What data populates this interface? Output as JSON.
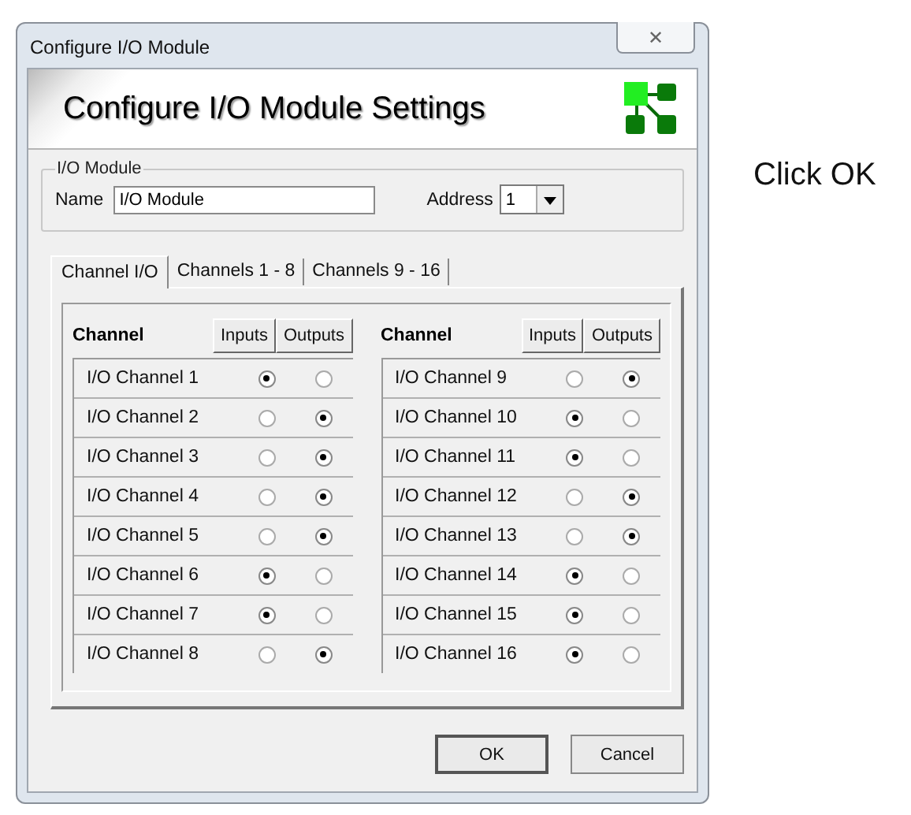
{
  "window": {
    "title": "Configure I/O Module",
    "close_label": "✕"
  },
  "banner": {
    "title": "Configure I/O Module Settings"
  },
  "module_group": {
    "legend": "I/O Module",
    "name_label": "Name",
    "name_value": "I/O Module",
    "address_label": "Address",
    "address_value": "1"
  },
  "tabs": [
    {
      "label": "Channel I/O",
      "selected": true
    },
    {
      "label": "Channels 1 - 8",
      "selected": false
    },
    {
      "label": "Channels 9 - 16",
      "selected": false
    }
  ],
  "panels": [
    {
      "heading": "Channel",
      "columns": [
        "Inputs",
        "Outputs"
      ],
      "rows": [
        {
          "name": "I/O Channel 1",
          "radios": [
            {
              "selected": true
            },
            {
              "selected": false
            }
          ]
        },
        {
          "name": "I/O Channel 2",
          "radios": [
            {
              "selected": false
            },
            {
              "selected": true
            }
          ]
        },
        {
          "name": "I/O Channel 3",
          "radios": [
            {
              "selected": false
            },
            {
              "selected": true
            }
          ]
        },
        {
          "name": "I/O Channel 4",
          "radios": [
            {
              "selected": false
            },
            {
              "selected": true
            }
          ]
        },
        {
          "name": "I/O Channel 5",
          "radios": [
            {
              "selected": false
            },
            {
              "selected": true
            }
          ]
        },
        {
          "name": "I/O Channel 6",
          "radios": [
            {
              "selected": true
            },
            {
              "selected": false
            }
          ]
        },
        {
          "name": "I/O Channel 7",
          "radios": [
            {
              "selected": true
            },
            {
              "selected": false
            }
          ]
        },
        {
          "name": "I/O Channel 8",
          "radios": [
            {
              "selected": false
            },
            {
              "selected": true
            }
          ]
        }
      ]
    },
    {
      "heading": "Channel",
      "columns": [
        "Inputs",
        "Outputs"
      ],
      "rows": [
        {
          "name": "I/O Channel 9",
          "radios": [
            {
              "selected": false
            },
            {
              "selected": true
            }
          ]
        },
        {
          "name": "I/O Channel 10",
          "radios": [
            {
              "selected": true
            },
            {
              "selected": false
            }
          ]
        },
        {
          "name": "I/O Channel 11",
          "radios": [
            {
              "selected": true
            },
            {
              "selected": false
            }
          ]
        },
        {
          "name": "I/O Channel 12",
          "radios": [
            {
              "selected": false
            },
            {
              "selected": true
            }
          ]
        },
        {
          "name": "I/O Channel 13",
          "radios": [
            {
              "selected": false
            },
            {
              "selected": true
            }
          ]
        },
        {
          "name": "I/O Channel 14",
          "radios": [
            {
              "selected": true
            },
            {
              "selected": false
            }
          ]
        },
        {
          "name": "I/O Channel 15",
          "radios": [
            {
              "selected": true
            },
            {
              "selected": false
            }
          ]
        },
        {
          "name": "I/O Channel 16",
          "radios": [
            {
              "selected": true
            },
            {
              "selected": false
            }
          ]
        }
      ]
    }
  ],
  "buttons": [
    {
      "label": "OK",
      "default": true
    },
    {
      "label": "Cancel",
      "default": false
    }
  ],
  "instruction": "Click OK"
}
